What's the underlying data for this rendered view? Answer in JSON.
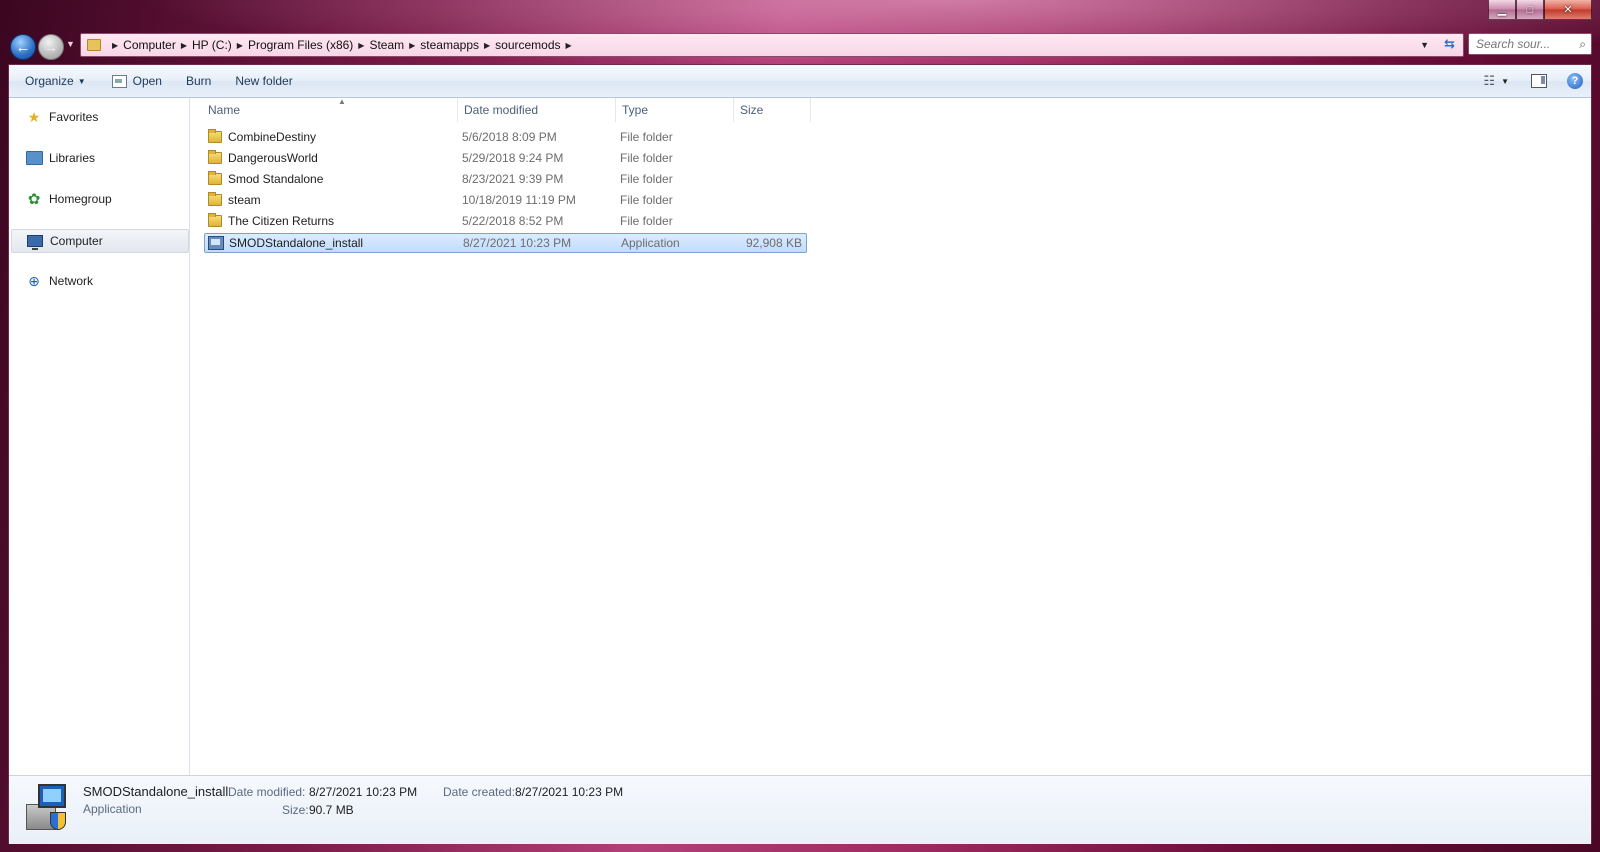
{
  "address": {
    "crumbs": [
      "Computer",
      "HP (C:)",
      "Program Files (x86)",
      "Steam",
      "steamapps",
      "sourcemods"
    ]
  },
  "search": {
    "placeholder": "Search sour..."
  },
  "toolbar": {
    "organize": "Organize",
    "open": "Open",
    "burn": "Burn",
    "new_folder": "New folder"
  },
  "nav": {
    "favorites": "Favorites",
    "libraries": "Libraries",
    "homegroup": "Homegroup",
    "computer": "Computer",
    "network": "Network"
  },
  "columns": {
    "name": "Name",
    "date": "Date modified",
    "type": "Type",
    "size": "Size"
  },
  "files": [
    {
      "name": "CombineDestiny",
      "date": "5/6/2018 8:09 PM",
      "type": "File folder",
      "size": ""
    },
    {
      "name": "DangerousWorld",
      "date": "5/29/2018 9:24 PM",
      "type": "File folder",
      "size": ""
    },
    {
      "name": "Smod Standalone",
      "date": "8/23/2021 9:39 PM",
      "type": "File folder",
      "size": ""
    },
    {
      "name": "steam",
      "date": "10/18/2019 11:19 PM",
      "type": "File folder",
      "size": ""
    },
    {
      "name": "The Citizen Returns",
      "date": "5/22/2018 8:52 PM",
      "type": "File folder",
      "size": ""
    },
    {
      "name": "SMODStandalone_install",
      "date": "8/27/2021 10:23 PM",
      "type": "Application",
      "size": "92,908 KB"
    }
  ],
  "details": {
    "name": "SMODStandalone_install",
    "type": "Application",
    "date_modified_label": "Date modified:",
    "date_modified": "8/27/2021 10:23 PM",
    "size_label": "Size:",
    "size": "90.7 MB",
    "date_created_label": "Date created:",
    "date_created": "8/27/2021 10:23 PM"
  }
}
